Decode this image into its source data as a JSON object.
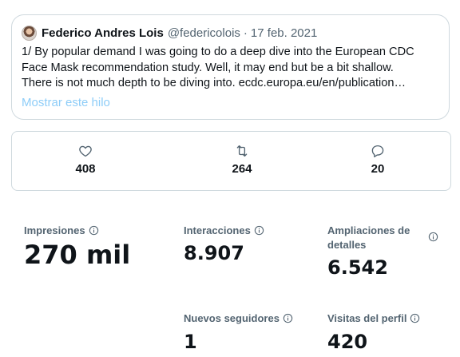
{
  "tweet": {
    "author_name": "Federico Andres Lois",
    "author_handle": "@federicolois",
    "separator": "·",
    "date": "17 feb. 2021",
    "text_lines": [
      "1/ By popular demand I was going to do a deep dive into the European CDC",
      "Face Mask recommendation study. Well, it may end but be a bit shallow.",
      "There is not much depth to be diving into. ecdc.europa.eu/en/publication…"
    ],
    "show_thread_label": "Mostrar este hilo",
    "show_thread_color": "#8ecdf8"
  },
  "engagement": {
    "likes": "408",
    "retweets": "264",
    "replies": "20",
    "icons": [
      "heart-icon",
      "retweet-icon",
      "reply-icon"
    ]
  },
  "metrics": {
    "impressions": {
      "label": "Impresiones",
      "value": "270 mil"
    },
    "interactions": {
      "label": "Interacciones",
      "value": "8.907"
    },
    "detail_expands": {
      "label_line1": "Ampliaciones de",
      "label_line2": "detalles",
      "value": "6.542"
    },
    "new_followers": {
      "label": "Nuevos seguidores",
      "value": "1"
    },
    "profile_visits": {
      "label": "Visitas del perfil",
      "value": "420"
    }
  },
  "colors": {
    "text_primary": "#0f1419",
    "text_secondary": "#536471",
    "border": "#cfd9de"
  }
}
